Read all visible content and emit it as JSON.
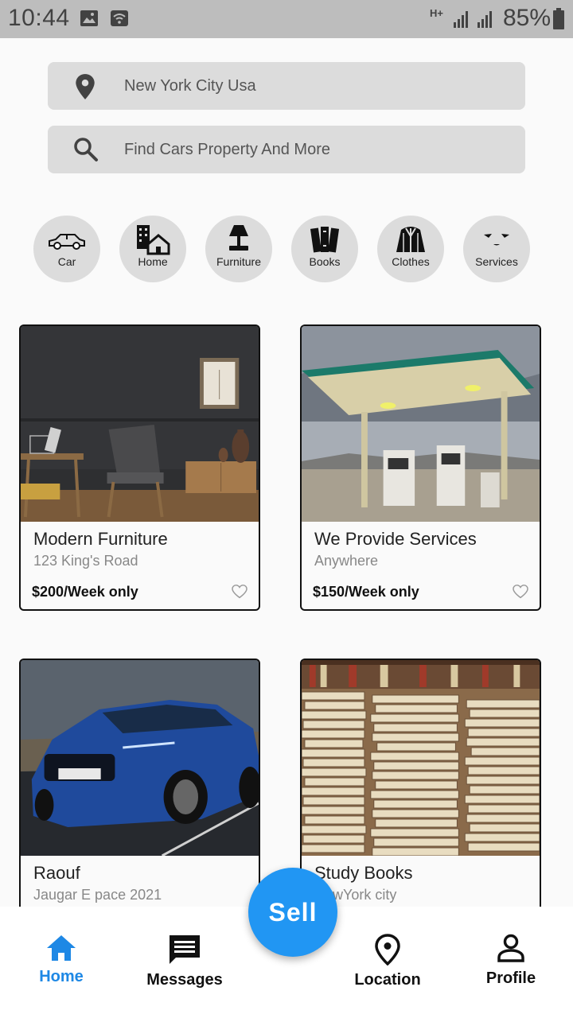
{
  "status_bar": {
    "time": "10:44",
    "battery": "85%",
    "network": "H+",
    "icons": [
      "image-icon",
      "wifi-icon",
      "signal-icon",
      "battery-icon"
    ]
  },
  "search": {
    "location_value": "New York City Usa",
    "query_placeholder": "Find Cars Property And More"
  },
  "categories": [
    {
      "label": "Car",
      "icon": "car-icon"
    },
    {
      "label": "Home",
      "icon": "home-building-icon"
    },
    {
      "label": "Furniture",
      "icon": "lamp-icon"
    },
    {
      "label": "Books",
      "icon": "books-icon"
    },
    {
      "label": "Clothes",
      "icon": "jacket-icon"
    },
    {
      "label": "Services",
      "icon": "face-icon"
    }
  ],
  "listings": [
    {
      "title": "Modern Furniture",
      "subtitle": "123 King's Road",
      "price": "$200/Week only"
    },
    {
      "title": "We Provide Services",
      "subtitle": "Anywhere",
      "price": "$150/Week only"
    },
    {
      "title": "Raouf",
      "subtitle": "Jaugar E pace 2021",
      "price": ""
    },
    {
      "title": "Study Books",
      "subtitle": "NewYork city",
      "price": ""
    }
  ],
  "fab": {
    "label": "Sell"
  },
  "nav": [
    {
      "label": "Home",
      "icon": "home-icon",
      "active": true
    },
    {
      "label": "Messages",
      "icon": "message-icon",
      "active": false
    },
    {
      "label": "Location",
      "icon": "location-pin-icon",
      "active": false
    },
    {
      "label": "Profile",
      "icon": "person-icon",
      "active": false
    }
  ],
  "colors": {
    "accent": "#2196f3",
    "active_nav": "#1e88e5",
    "field_bg": "#dcdcdc"
  }
}
